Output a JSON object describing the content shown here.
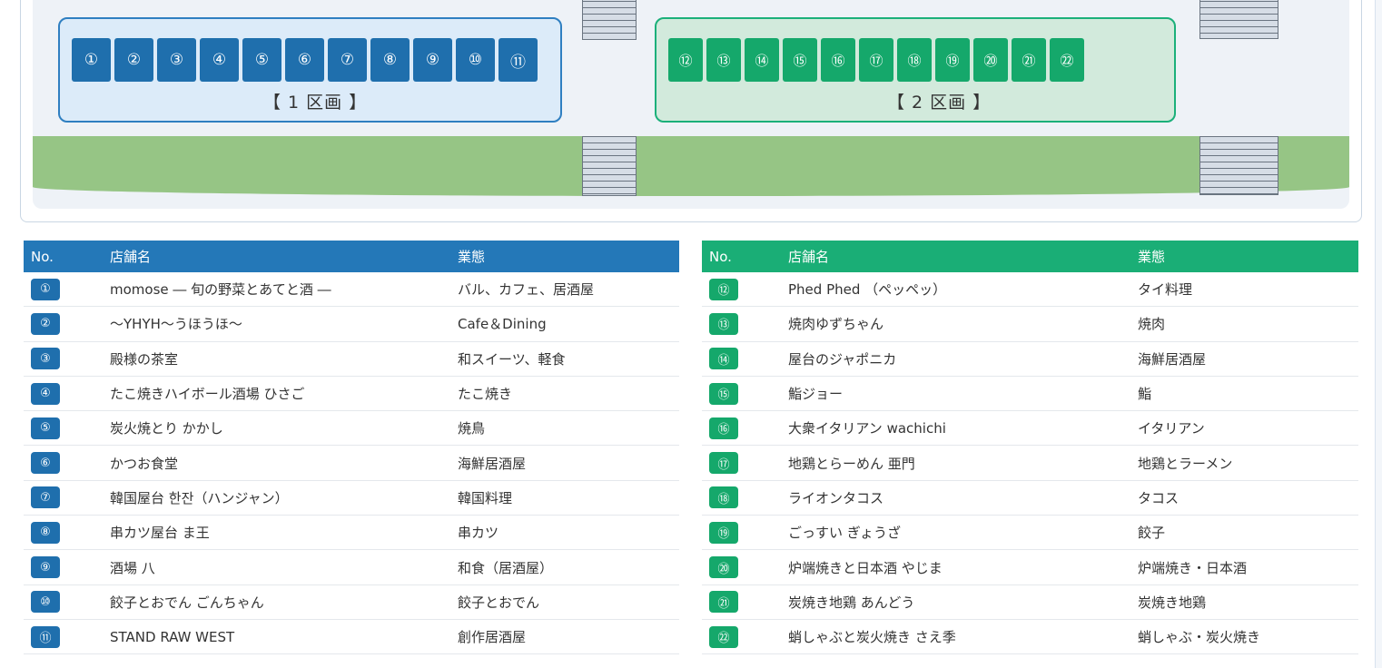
{
  "map": {
    "zone1": {
      "label": "【 1 区画 】",
      "stalls": [
        "①",
        "②",
        "③",
        "④",
        "⑤",
        "⑥",
        "⑦",
        "⑧",
        "⑨",
        "⑩",
        "⑪"
      ]
    },
    "zone2": {
      "label": "【 2 区画 】",
      "stalls": [
        "⑫",
        "⑬",
        "⑭",
        "⑮",
        "⑯",
        "⑰",
        "⑱",
        "⑲",
        "⑳",
        "㉑",
        "㉒"
      ]
    }
  },
  "table_headers": {
    "no": "No.",
    "name": "店舗名",
    "type": "業態"
  },
  "colors": {
    "zone1_accent": "#1f6fad",
    "zone2_accent": "#15a86b",
    "grass": "#96c585"
  },
  "left_table": [
    {
      "no": "①",
      "name": "momose ― 旬の野菜とあてと酒 ―",
      "type": "バル、カフェ、居酒屋"
    },
    {
      "no": "②",
      "name": "〜YHYH〜うほうほ〜",
      "type": "Cafe＆Dining"
    },
    {
      "no": "③",
      "name": "殿様の茶室",
      "type": "和スイーツ、軽食"
    },
    {
      "no": "④",
      "name": "たこ焼きハイボール酒場 ひさご",
      "type": "たこ焼き"
    },
    {
      "no": "⑤",
      "name": "炭火焼とり かかし",
      "type": "焼鳥"
    },
    {
      "no": "⑥",
      "name": "かつお食堂",
      "type": "海鮮居酒屋"
    },
    {
      "no": "⑦",
      "name": "韓国屋台 한잔（ハンジャン）",
      "type": "韓国料理"
    },
    {
      "no": "⑧",
      "name": "串カツ屋台 ま王",
      "type": "串カツ"
    },
    {
      "no": "⑨",
      "name": "酒場 八",
      "type": "和食（居酒屋）"
    },
    {
      "no": "⑩",
      "name": "餃子とおでん ごんちゃん",
      "type": "餃子とおでん"
    },
    {
      "no": "⑪",
      "name": "STAND RAW WEST",
      "type": "創作居酒屋"
    }
  ],
  "right_table": [
    {
      "no": "⑫",
      "name": "Phed Phed （ペッペッ）",
      "type": "タイ料理"
    },
    {
      "no": "⑬",
      "name": "焼肉ゆずちゃん",
      "type": "焼肉"
    },
    {
      "no": "⑭",
      "name": "屋台のジャポニカ",
      "type": "海鮮居酒屋"
    },
    {
      "no": "⑮",
      "name": "鮨ジョー",
      "type": "鮨"
    },
    {
      "no": "⑯",
      "name": "大衆イタリアン wachichi",
      "type": "イタリアン"
    },
    {
      "no": "⑰",
      "name": "地鶏とらーめん 亜門",
      "type": "地鶏とラーメン"
    },
    {
      "no": "⑱",
      "name": "ライオンタコス",
      "type": "タコス"
    },
    {
      "no": "⑲",
      "name": "ごっすい ぎょうざ",
      "type": "餃子"
    },
    {
      "no": "⑳",
      "name": "炉端焼きと日本酒 やじま",
      "type": "炉端焼き・日本酒"
    },
    {
      "no": "㉑",
      "name": "炭焼き地鶏 あんどう",
      "type": "炭焼き地鶏"
    },
    {
      "no": "㉒",
      "name": "蛸しゃぶと炭火焼き さえ季",
      "type": "蛸しゃぶ・炭火焼き"
    }
  ]
}
